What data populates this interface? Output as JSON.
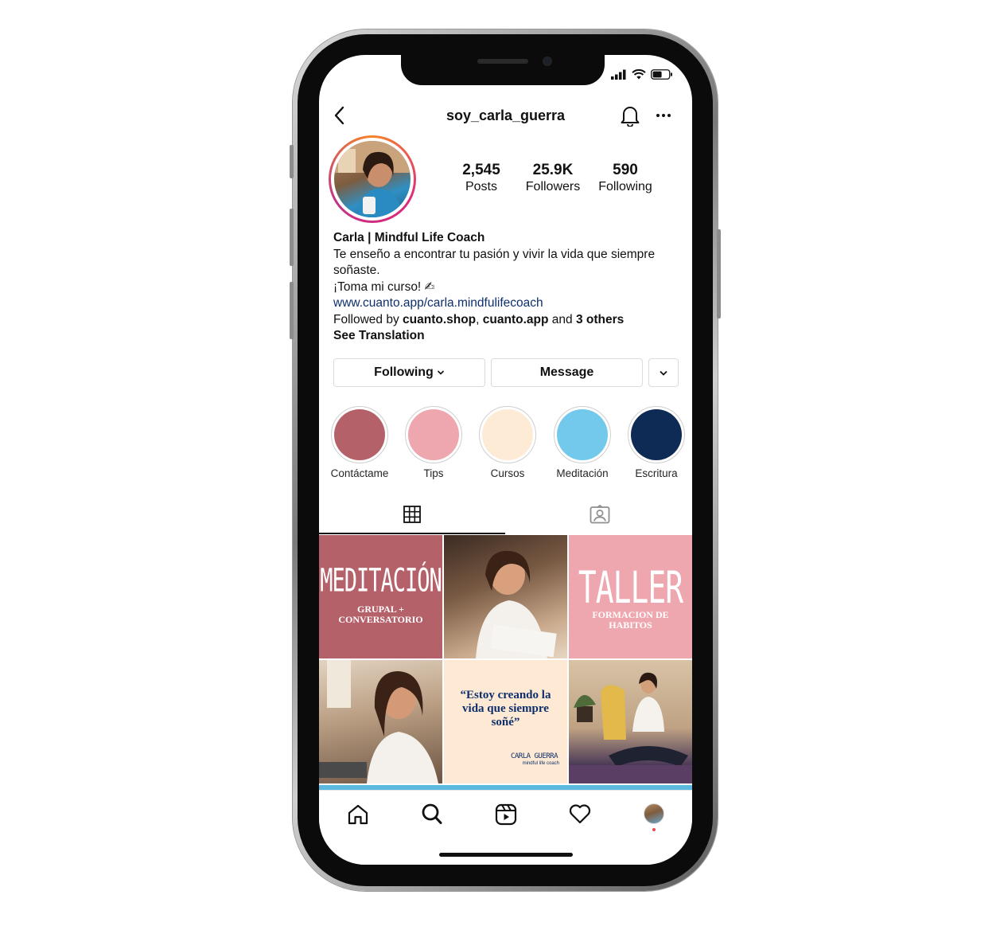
{
  "profile": {
    "username": "soy_carla_guerra",
    "stats": [
      {
        "num": "2,545",
        "label": "Posts"
      },
      {
        "num": "25.9K",
        "label": "Followers"
      },
      {
        "num": "590",
        "label": "Following"
      }
    ],
    "bio": {
      "name": "Carla | Mindful Life Coach",
      "line1": "Te enseño a encontrar tu pasión y vivir la vida que siempre soñaste.",
      "line2": "¡Toma mi curso! ✍",
      "link": "www.cuanto.app/carla.mindfulifecoach",
      "followed_prefix": "Followed by ",
      "followed_user1": "cuanto.shop",
      "followed_sep": ", ",
      "followed_user2": "cuanto.app",
      "followed_and": " and ",
      "followed_others": "3 others",
      "see_translation": "See Translation"
    }
  },
  "actions": {
    "following_label": "Following",
    "message_label": "Message"
  },
  "highlights": [
    {
      "label": "Contáctame",
      "color": "#b5616a"
    },
    {
      "label": "Tips",
      "color": "#eea7ae"
    },
    {
      "label": "Cursos",
      "color": "#fdebd6"
    },
    {
      "label": "Meditación",
      "color": "#72c9ec"
    },
    {
      "label": "Escritura",
      "color": "#0d2b55"
    }
  ],
  "posts": {
    "tile1_big": "MEDITACIÓN",
    "tile1_small": "GRUPAL + CONVERSATORIO",
    "tile3_big": "TALLER",
    "tile3_small": "FORMACION DE HABITOS",
    "tile5_quote": "“Estoy creando la vida que siempre soñé”",
    "tile5_brand": "CARLA GUERRA",
    "tile5_sub": "mindful life coach"
  },
  "colors": {
    "rose": "#b5616a",
    "pink": "#eea7ae",
    "cream": "#fde9d4",
    "navy": "#0d2f6b"
  }
}
